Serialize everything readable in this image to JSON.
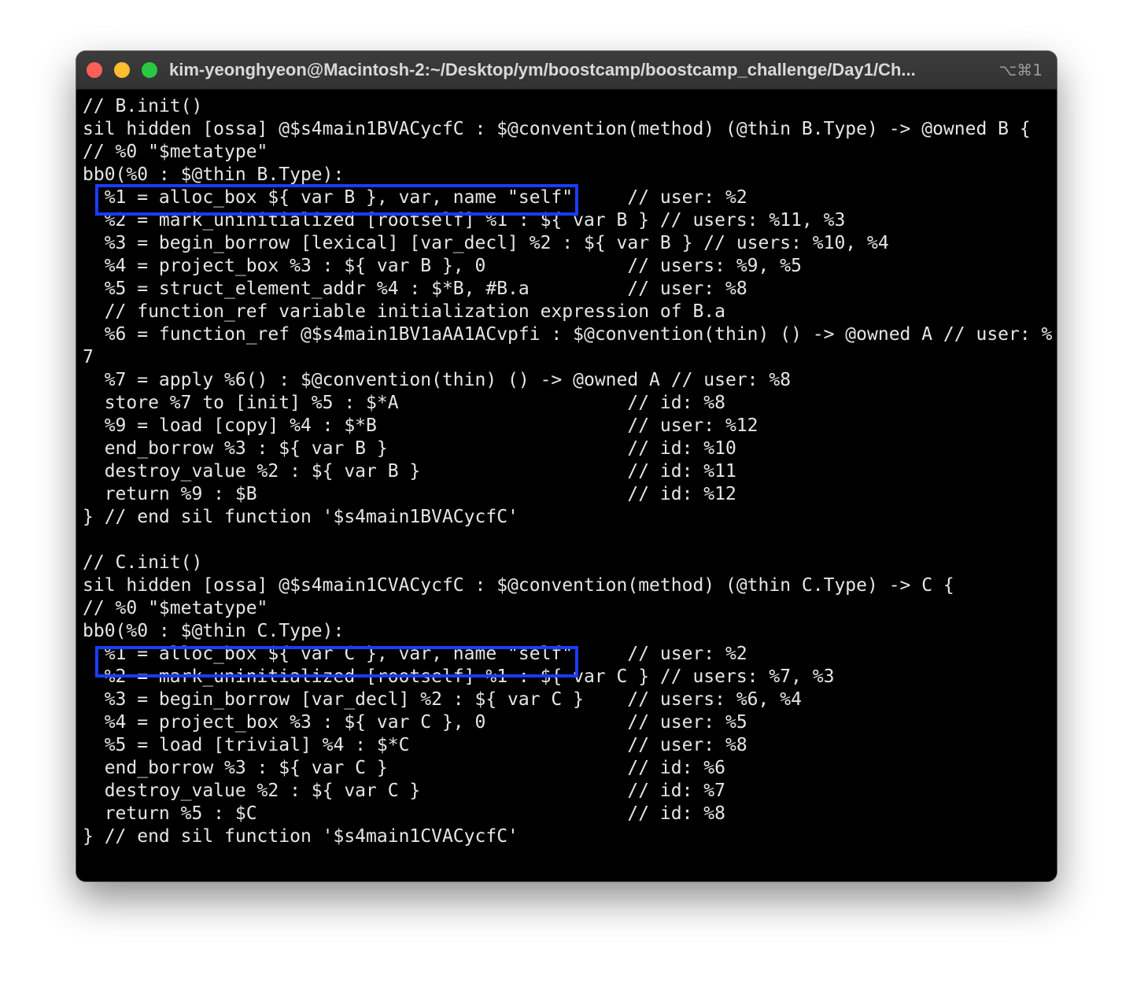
{
  "window": {
    "title": "kim-yeonghyeon@Macintosh-2:~/Desktop/ym/boostcamp/boostcamp_challenge/Day1/Ch...",
    "shortcut": "⌥⌘1"
  },
  "terminal": {
    "lines": [
      "// B.init()",
      "sil hidden [ossa] @$s4main1BVACycfC : $@convention(method) (@thin B.Type) -> @owned B {",
      "// %0 \"$metatype\"",
      "bb0(%0 : $@thin B.Type):",
      "  %1 = alloc_box ${ var B }, var, name \"self\"     // user: %2",
      "  %2 = mark_uninitialized [rootself] %1 : ${ var B } // users: %11, %3",
      "  %3 = begin_borrow [lexical] [var_decl] %2 : ${ var B } // users: %10, %4",
      "  %4 = project_box %3 : ${ var B }, 0             // users: %9, %5",
      "  %5 = struct_element_addr %4 : $*B, #B.a         // user: %8",
      "  // function_ref variable initialization expression of B.a",
      "  %6 = function_ref @$s4main1BV1aAA1ACvpfi : $@convention(thin) () -> @owned A // user: %",
      "7",
      "  %7 = apply %6() : $@convention(thin) () -> @owned A // user: %8",
      "  store %7 to [init] %5 : $*A                     // id: %8",
      "  %9 = load [copy] %4 : $*B                       // user: %12",
      "  end_borrow %3 : ${ var B }                      // id: %10",
      "  destroy_value %2 : ${ var B }                   // id: %11",
      "  return %9 : $B                                  // id: %12",
      "} // end sil function '$s4main1BVACycfC'",
      "",
      "// C.init()",
      "sil hidden [ossa] @$s4main1CVACycfC : $@convention(method) (@thin C.Type) -> C {",
      "// %0 \"$metatype\"",
      "bb0(%0 : $@thin C.Type):",
      "  %1 = alloc_box ${ var C }, var, name \"self\"     // user: %2",
      "  %2 = mark_uninitialized [rootself] %1 : ${ var C } // users: %7, %3",
      "  %3 = begin_borrow [var_decl] %2 : ${ var C }    // users: %6, %4",
      "  %4 = project_box %3 : ${ var C }, 0             // user: %5",
      "  %5 = load [trivial] %4 : $*C                    // user: %8",
      "  end_borrow %3 : ${ var C }                      // id: %6",
      "  destroy_value %2 : ${ var C }                   // id: %7",
      "  return %5 : $C                                  // id: %8",
      "} // end sil function '$s4main1CVACycfC'"
    ]
  },
  "colors": {
    "highlight_border": "#1a3cff",
    "terminal_text": "#e6e6e6",
    "terminal_bg": "#000000"
  }
}
